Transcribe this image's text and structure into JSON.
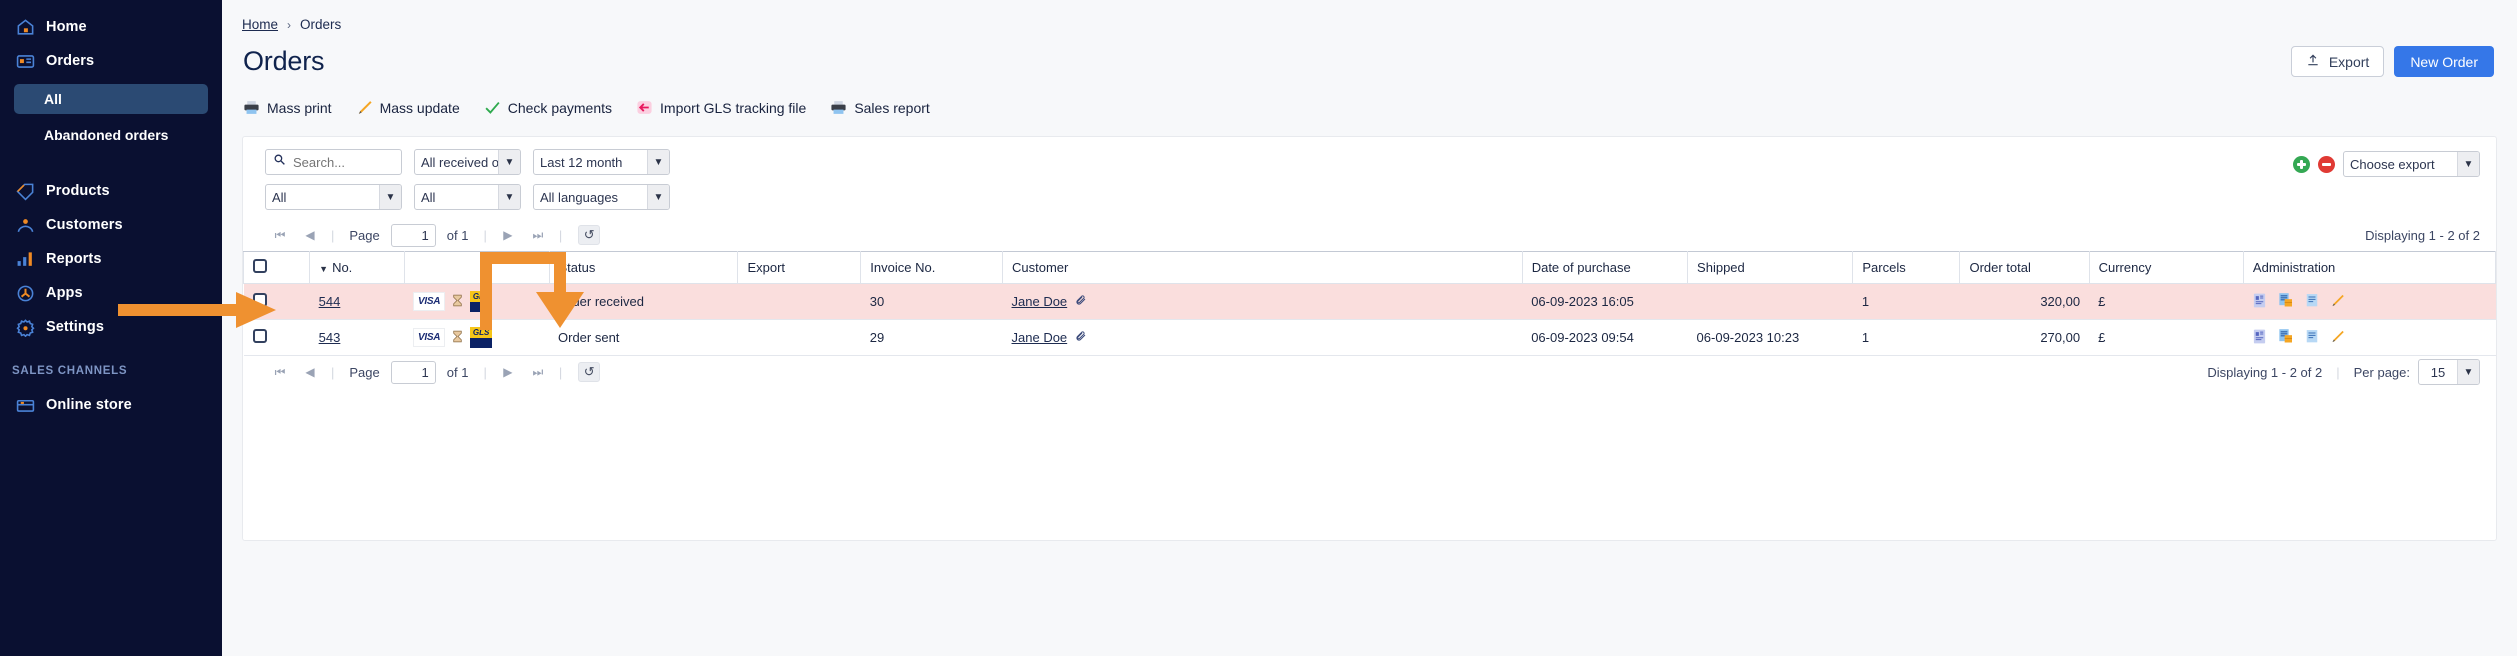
{
  "sidebar": {
    "items": [
      {
        "label": "Home",
        "icon": "home-icon"
      },
      {
        "label": "Orders",
        "icon": "orders-icon"
      }
    ],
    "orders_sub": [
      {
        "label": "All",
        "active": true
      },
      {
        "label": "Abandoned orders",
        "active": false
      }
    ],
    "items2": [
      {
        "label": "Products",
        "icon": "tag-icon"
      },
      {
        "label": "Customers",
        "icon": "customers-icon"
      },
      {
        "label": "Reports",
        "icon": "reports-icon"
      },
      {
        "label": "Apps",
        "icon": "apps-icon"
      },
      {
        "label": "Settings",
        "icon": "gear-icon"
      }
    ],
    "section_title": "SALES CHANNELS",
    "channels": [
      {
        "label": "Online store",
        "icon": "store-icon"
      }
    ]
  },
  "breadcrumb": {
    "home": "Home",
    "separator": "›",
    "current": "Orders"
  },
  "header": {
    "title": "Orders",
    "export_label": "Export",
    "export_icon": "upload-icon",
    "new_order_label": "New Order",
    "accent_blue": "#3577e8"
  },
  "toolbar": [
    {
      "label": "Mass print",
      "icon": "printer-icon"
    },
    {
      "label": "Mass update",
      "icon": "pencil-icon"
    },
    {
      "label": "Check payments",
      "icon": "check-icon"
    },
    {
      "label": "Import GLS tracking file",
      "icon": "import-arrow-icon"
    },
    {
      "label": "Sales report",
      "icon": "printer-icon"
    }
  ],
  "filters": {
    "search_placeholder": "Search...",
    "search_value": "",
    "row1": [
      {
        "name": "status-filter",
        "value": "All received or"
      },
      {
        "name": "period-filter",
        "value": "Last 12 month"
      }
    ],
    "row2": [
      {
        "name": "filter-all-1",
        "value": "All"
      },
      {
        "name": "filter-all-2",
        "value": "All"
      },
      {
        "name": "language-filter",
        "value": "All languages"
      }
    ],
    "choose_export": "Choose export",
    "add_icon": "plus-circle-icon",
    "remove_icon": "minus-circle-icon"
  },
  "pager": {
    "first": "⏮",
    "prev": "◀",
    "next": "▶",
    "last": "⏭",
    "page_label": "Page",
    "page_value": "1",
    "of_label": "of 1",
    "refresh_icon": "refresh-icon",
    "displaying": "Displaying 1 - 2 of 2",
    "per_page_label": "Per page:",
    "per_page_value": "15"
  },
  "table": {
    "columns": [
      {
        "key": "check",
        "label": ""
      },
      {
        "key": "no",
        "label": "No.",
        "sorted": true
      },
      {
        "key": "payment",
        "label": ""
      },
      {
        "key": "status",
        "label": "Status"
      },
      {
        "key": "export",
        "label": "Export"
      },
      {
        "key": "invoice",
        "label": "Invoice No."
      },
      {
        "key": "customer",
        "label": "Customer"
      },
      {
        "key": "date",
        "label": "Date of purchase"
      },
      {
        "key": "shipped",
        "label": "Shipped"
      },
      {
        "key": "parcels",
        "label": "Parcels"
      },
      {
        "key": "total",
        "label": "Order total"
      },
      {
        "key": "currency",
        "label": "Currency"
      },
      {
        "key": "admin",
        "label": "Administration"
      }
    ],
    "rows": [
      {
        "no": "544",
        "status": "Order received",
        "export": "",
        "invoice": "30",
        "customer": "Jane Doe",
        "date": "06-09-2023 16:05",
        "shipped": "",
        "parcels": "1",
        "total": "320,00",
        "currency": "£",
        "payment_icon": "visa-card-icon",
        "pending_icon": "hourglass-icon",
        "carrier_icon": "gls-icon",
        "highlight": true
      },
      {
        "no": "543",
        "status": "Order sent",
        "export": "",
        "invoice": "29",
        "customer": "Jane Doe",
        "date": "06-09-2023 09:54",
        "shipped": "06-09-2023 10:23",
        "parcels": "1",
        "total": "270,00",
        "currency": "£",
        "payment_icon": "visa-card-icon",
        "pending_icon": "hourglass-icon",
        "carrier_icon": "gls-icon",
        "highlight": false
      }
    ],
    "visa_label": "VISA",
    "gls_label": "GLS",
    "admin_icons": [
      "order-details-icon",
      "packing-slip-icon",
      "invoice-icon",
      "edit-pencil-icon"
    ]
  },
  "annotations": {
    "arrow_color": "#ef9130",
    "arrow_row_target": "row-544-checkbox",
    "arrow_bent_target": "gls-carrier-icon"
  }
}
